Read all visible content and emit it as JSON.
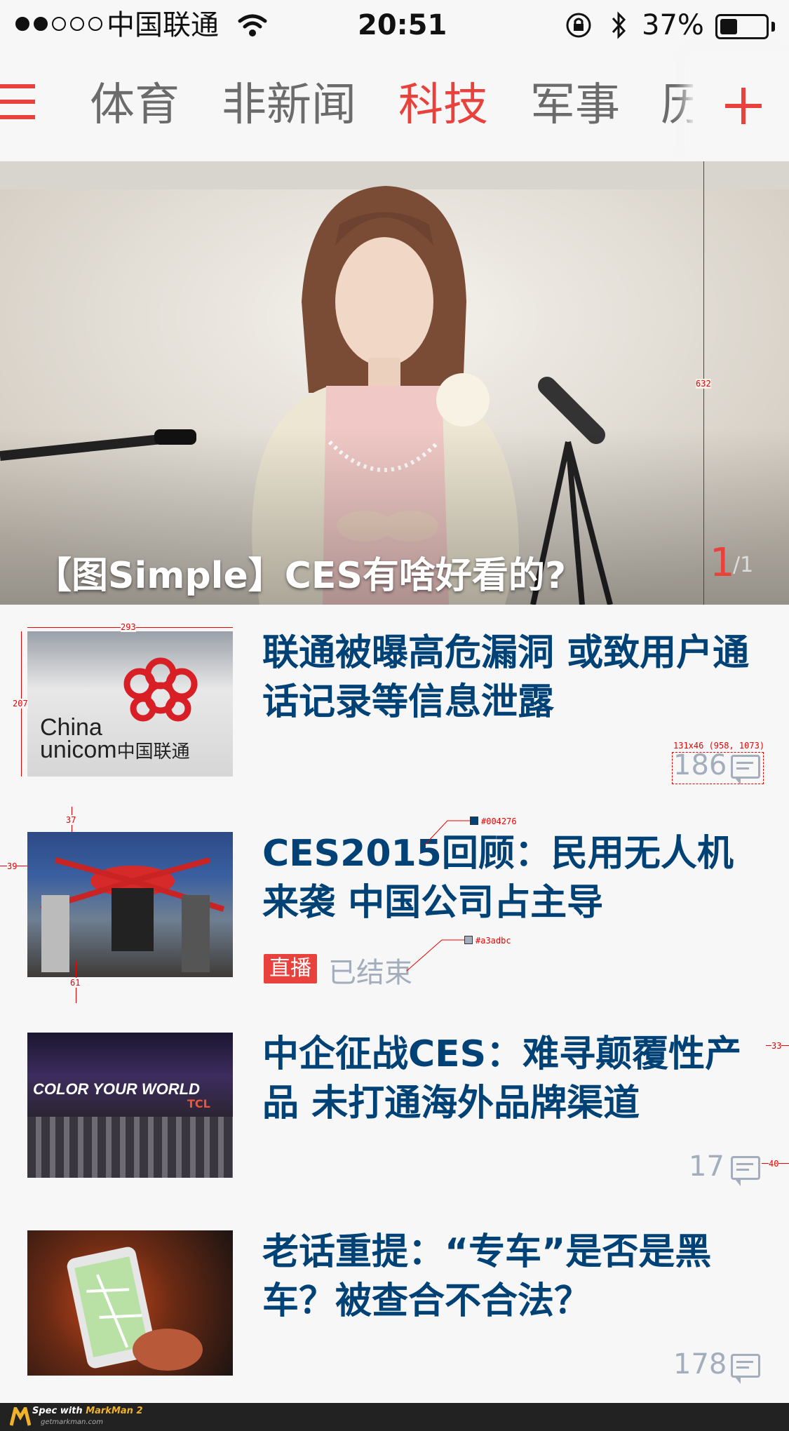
{
  "status_bar": {
    "carrier": "中国联通",
    "time": "20:51",
    "battery": "37%",
    "battery_level": 0.37,
    "signal_strength": 2,
    "icons": [
      "wifi-icon",
      "rotation-lock-icon",
      "bluetooth-icon",
      "battery-icon"
    ]
  },
  "nav": {
    "tabs": [
      {
        "label": "体育",
        "active": false
      },
      {
        "label": "非新闻",
        "active": false
      },
      {
        "label": "科技",
        "active": true
      },
      {
        "label": "军事",
        "active": false
      },
      {
        "label": "历",
        "active": false
      }
    ],
    "accent_color": "#e9413b",
    "inactive_color": "#6b6b6b"
  },
  "hero": {
    "title": "【图Simple】CES有啥好看的?",
    "page_current": "1",
    "page_total": "/1"
  },
  "articles": [
    {
      "title": "联通被曝高危漏洞 或致用户通话记录等信息泄露",
      "comments": "186",
      "thumb_label_1": "China",
      "thumb_label_2": "unicom",
      "thumb_label_3": "中国联通"
    },
    {
      "title": "CES2015回顾：民用无人机来袭 中国公司占主导",
      "badge": "直播",
      "status": "已结束"
    },
    {
      "title": "中企征战CES：难寻颠覆性产品 未打通海外品牌渠道",
      "comments": "17",
      "thumb_label": "COLOR YOUR WORLD",
      "thumb_label_2": "TCL"
    },
    {
      "title": "老话重提：“专车”是否是黑车？被查合不合法？",
      "comments": "178"
    }
  ],
  "colors": {
    "title": "#004276",
    "meta": "#a3adbc"
  },
  "annotations": {
    "hero_height": "632",
    "thumb_width": "293",
    "thumb_height": "207",
    "comment_box": "131x46 (958, 1073)",
    "row_gap": "37",
    "left_pad": "39",
    "bottom_gap": "61",
    "title_color_label": "#004276",
    "meta_color_label": "#a3adbc",
    "right_pad": "33",
    "icon_pad": "40"
  },
  "footer": {
    "brand_prefix": "Spec with",
    "brand": "MarkMan 2",
    "url": "getmarkman.com"
  }
}
